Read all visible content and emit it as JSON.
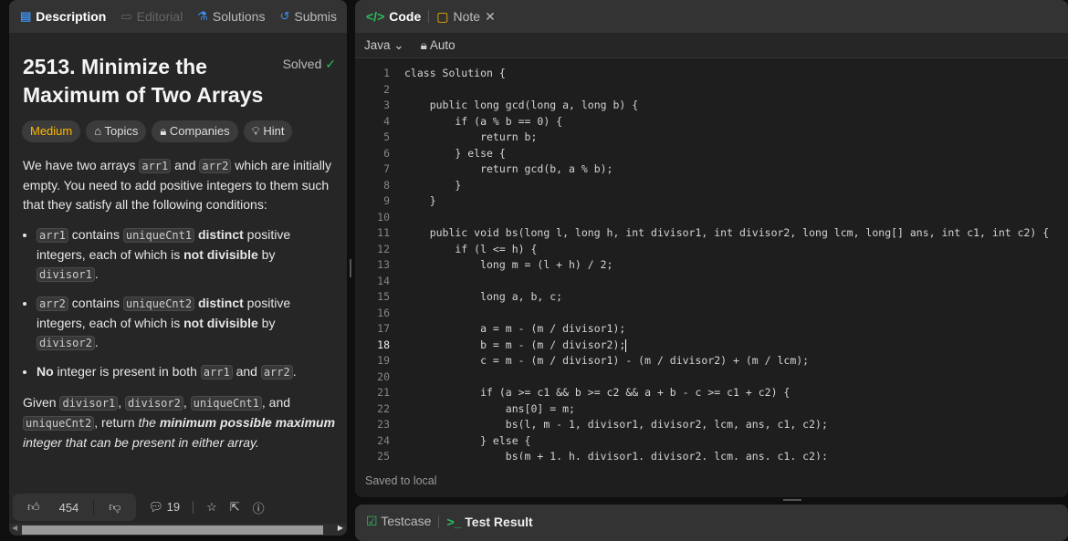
{
  "left_tabs": [
    {
      "label": "Description",
      "icon": "description-icon"
    },
    {
      "label": "Editorial",
      "icon": "book-icon"
    },
    {
      "label": "Solutions",
      "icon": "flask-icon"
    },
    {
      "label": "Submis",
      "icon": "history-icon"
    }
  ],
  "problem": {
    "title": "2513. Minimize the Maximum of Two Arrays",
    "status": "Solved",
    "difficulty": "Medium",
    "chips": [
      "Topics",
      "Companies",
      "Hint"
    ]
  },
  "description": {
    "intro": [
      {
        "t": "We have two arrays "
      },
      {
        "t": "arr1",
        "s": "code"
      },
      {
        "t": " and "
      },
      {
        "t": "arr2",
        "s": "code"
      },
      {
        "t": " which are initially empty. You need to add positive integers to them such that they satisfy all the following conditions:"
      }
    ],
    "bullets": [
      [
        {
          "t": "arr1",
          "s": "code"
        },
        {
          "t": " contains "
        },
        {
          "t": "uniqueCnt1",
          "s": "code"
        },
        {
          "t": " "
        },
        {
          "t": "distinct",
          "s": "b"
        },
        {
          "t": " positive integers, each of which is "
        },
        {
          "t": "not divisible",
          "s": "b"
        },
        {
          "t": " by "
        },
        {
          "t": "divisor1",
          "s": "code"
        },
        {
          "t": "."
        }
      ],
      [
        {
          "t": "arr2",
          "s": "code"
        },
        {
          "t": " contains "
        },
        {
          "t": "uniqueCnt2",
          "s": "code"
        },
        {
          "t": " "
        },
        {
          "t": "distinct",
          "s": "b"
        },
        {
          "t": " positive integers, each of which is "
        },
        {
          "t": "not divisible",
          "s": "b"
        },
        {
          "t": " by "
        },
        {
          "t": "divisor2",
          "s": "code"
        },
        {
          "t": "."
        }
      ],
      [
        {
          "t": "No",
          "s": "b"
        },
        {
          "t": " integer is present in both "
        },
        {
          "t": "arr1",
          "s": "code"
        },
        {
          "t": " and "
        },
        {
          "t": "arr2",
          "s": "code"
        },
        {
          "t": "."
        }
      ]
    ],
    "outro": [
      {
        "t": "Given "
      },
      {
        "t": "divisor1",
        "s": "code"
      },
      {
        "t": ", "
      },
      {
        "t": "divisor2",
        "s": "code"
      },
      {
        "t": ", "
      },
      {
        "t": "uniqueCnt1",
        "s": "code"
      },
      {
        "t": ", and "
      },
      {
        "t": "uniqueCnt2",
        "s": "code"
      },
      {
        "t": ", return "
      },
      {
        "t": "the ",
        "s": "i"
      },
      {
        "t": "minimum possible maximum",
        "s": "bi"
      },
      {
        "t": " integer that can be present in either array.",
        "s": "i"
      }
    ]
  },
  "footer": {
    "likes": "454",
    "comments": "19"
  },
  "editor": {
    "tabs": [
      "Code",
      "Note"
    ],
    "language": "Java",
    "mode": "Auto",
    "saved": "Saved to local",
    "cursor_line": 18,
    "lines": [
      "class Solution {",
      "",
      "    public long gcd(long a, long b) {",
      "        if (a % b == 0) {",
      "            return b;",
      "        } else {",
      "            return gcd(b, a % b);",
      "        }",
      "    }",
      "",
      "    public void bs(long l, long h, int divisor1, int divisor2, long lcm, long[] ans, int c1, int c2) {",
      "        if (l <= h) {",
      "            long m = (l + h) / 2;",
      "",
      "            long a, b, c;",
      "",
      "            a = m - (m / divisor1);",
      "            b = m - (m / divisor2);",
      "            c = m - (m / divisor1) - (m / divisor2) + (m / lcm);",
      "",
      "            if (a >= c1 && b >= c2 && a + b - c >= c1 + c2) {",
      "                ans[0] = m;",
      "                bs(l, m - 1, divisor1, divisor2, lcm, ans, c1, c2);",
      "            } else {",
      "                bs(m + 1, h, divisor1, divisor2, lcm, ans, c1, c2);"
    ]
  },
  "bottom_tabs": [
    "Testcase",
    "Test Result"
  ],
  "colors": {
    "accent": "#2cbb5d",
    "medium": "#ffb800"
  }
}
